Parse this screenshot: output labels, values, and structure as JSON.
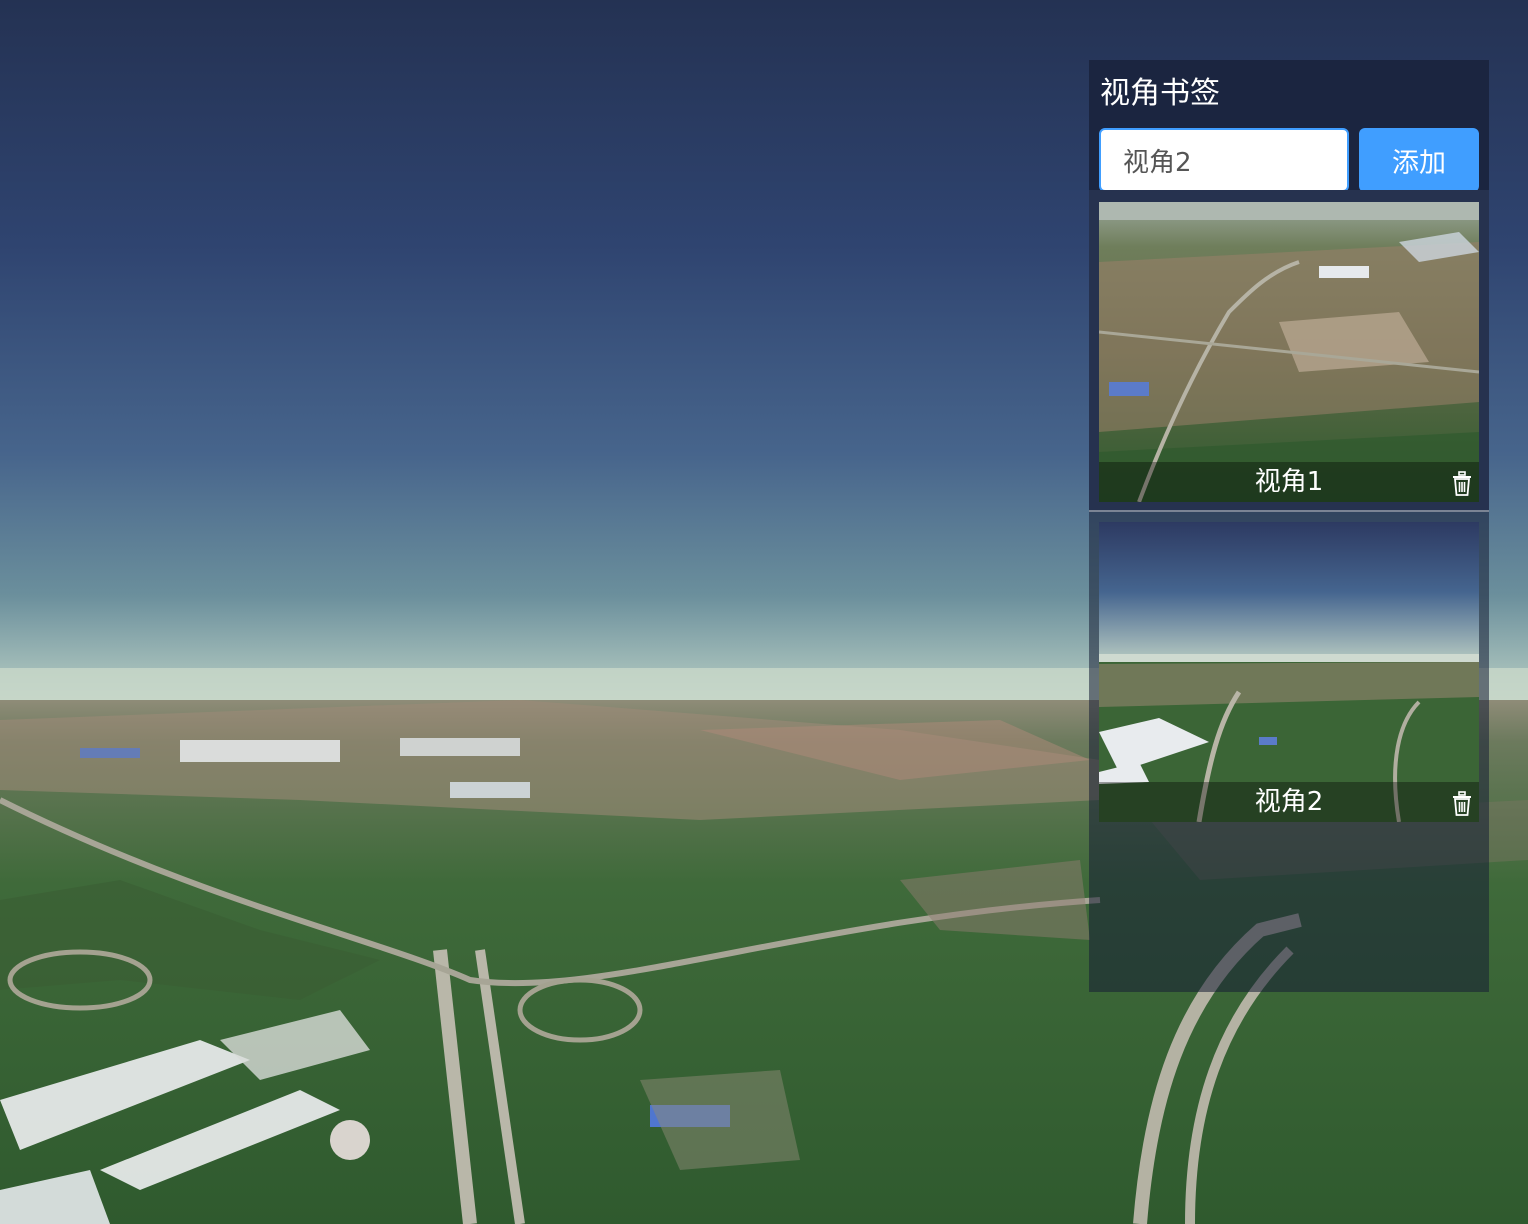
{
  "panel": {
    "title": "视角书签",
    "input": {
      "value": "视角2"
    },
    "add_label": "添加"
  },
  "bookmarks": [
    {
      "label": "视角1",
      "icon": "trash-icon"
    },
    {
      "label": "视角2",
      "icon": "trash-icon"
    }
  ],
  "colors": {
    "accent": "#409eff",
    "panel_header": "#1b2540"
  }
}
